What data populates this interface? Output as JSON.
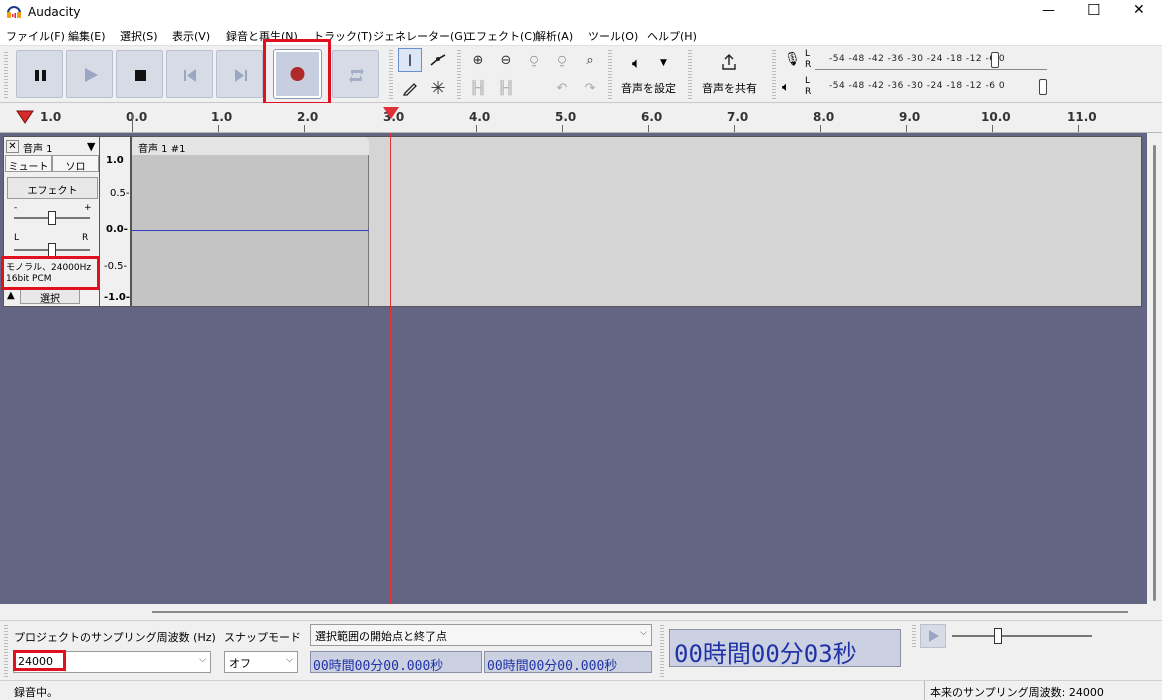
{
  "app": {
    "title": "Audacity"
  },
  "window_controls": {
    "minimize": "—",
    "maximize": "☐",
    "close": "✕"
  },
  "menu": [
    {
      "label": "ファイル(F)"
    },
    {
      "label": "編集(E)"
    },
    {
      "label": "選択(S)"
    },
    {
      "label": "表示(V)"
    },
    {
      "label": "録音と再生(N)"
    },
    {
      "label": "トラック(T)"
    },
    {
      "label": "ジェネレーター(G)"
    },
    {
      "label": "エフェクト(C)"
    },
    {
      "label": "解析(A)"
    },
    {
      "label": "ツール(O)"
    },
    {
      "label": "ヘルプ(H)"
    }
  ],
  "toolbar": {
    "audio_setup_label": "音声を設定",
    "share_audio_label": "音声を共有",
    "meter_scale": "-54 -48 -42 -36 -30 -24 -18 -12 -6 0",
    "meter_scale_play": "-54 -48 -42 -36 -30 -24 -18 -12 -6 0",
    "rec_meter_lr": [
      "L",
      "R"
    ],
    "play_meter_lr": [
      "L",
      "R"
    ]
  },
  "ruler": {
    "labels": [
      "1.0",
      "0.0",
      "1.0",
      "2.0",
      "3.0",
      "4.0",
      "5.0",
      "6.0",
      "7.0",
      "8.0",
      "9.0",
      "10.0",
      "11.0"
    ]
  },
  "track": {
    "name": "音声 1",
    "close_glyph": "✕",
    "mute_label": "ミュート",
    "solo_label": "ソロ",
    "effects_label": "エフェクト",
    "gain_minus": "-",
    "gain_plus": "+",
    "pan_l": "L",
    "pan_r": "R",
    "format_line1": "モノラル、24000Hz",
    "format_line2": "16bit PCM",
    "select_label": "選択",
    "clip_name": "音声 1 #1",
    "scale": [
      "1.0",
      "0.5-",
      "0.0-",
      "-0.5-",
      "-1.0-"
    ]
  },
  "bottom": {
    "project_rate_label": "プロジェクトのサンプリング周波数 (Hz)",
    "project_rate_value": "24000",
    "snap_label": "スナップモード",
    "snap_value": "オフ",
    "selection_mode": "選択範囲の開始点と終了点",
    "sel_start": "00時間00分00.000秒",
    "sel_end": "00時間00分00.000秒",
    "time_display": "00時間00分03秒"
  },
  "status": {
    "left": "録音中。",
    "right": "本来のサンプリング周波数: 24000"
  },
  "colors": {
    "annotation": "#e0101e",
    "track_bg": "#646583",
    "record_dot": "#b02a2a",
    "time_text": "#2132a8"
  }
}
